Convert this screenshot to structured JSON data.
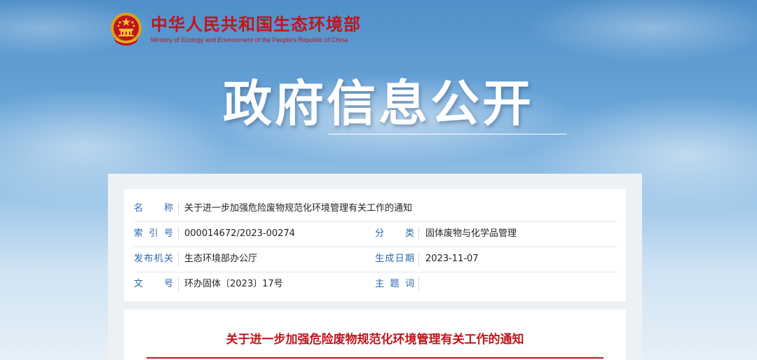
{
  "header": {
    "org_name_cn": "中华人民共和国生态环境部",
    "org_name_en": "Ministry of Ecology and Environment of the People's Republic of China",
    "emblem_icon": "national-emblem-icon"
  },
  "hero": {
    "title": "政府信息公开"
  },
  "metadata": {
    "name_label": "名　称",
    "name_value": "关于进一步加强危险废物规范化环境管理有关工作的通知",
    "index_label": "索引号",
    "index_value": "000014672/2023-00274",
    "category_label": "分　类",
    "category_value": "固体废物与化学品管理",
    "issuer_label": "发布机关",
    "issuer_value": "生态环境部办公厅",
    "date_label": "生成日期",
    "date_value": "2023-11-07",
    "docno_label": "文　号",
    "docno_value": "环办固体〔2023〕17号",
    "subject_label": "主题词",
    "subject_value": ""
  },
  "document": {
    "title": "关于进一步加强危险废物规范化环境管理有关工作的通知"
  },
  "colors": {
    "brand_red": "#c0151c",
    "label_blue": "#2a68ad",
    "sky_top": "#4f8fc9",
    "panel_bg": "#eef1f4"
  }
}
